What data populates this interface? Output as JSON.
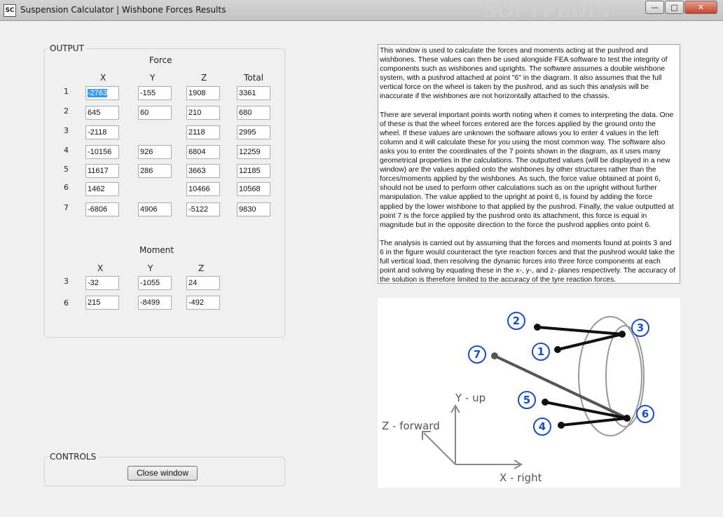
{
  "window": {
    "title": "Suspension Calculator | Wishbone Forces Results",
    "icon_text": "SC",
    "watermark": "SOFTPEDIA",
    "buttons": {
      "minimize": "—",
      "maximize": "□",
      "close": "✕"
    }
  },
  "output": {
    "group_label": "OUTPUT",
    "force": {
      "heading": "Force",
      "columns": [
        "X",
        "Y",
        "Z",
        "Total"
      ],
      "rows": [
        {
          "label": "1",
          "x": "-2763",
          "y": "-155",
          "z": "1908",
          "total": "3361"
        },
        {
          "label": "2",
          "x": "645",
          "y": "60",
          "z": "210",
          "total": "680"
        },
        {
          "label": "3",
          "x": "-2118",
          "y": "",
          "z": "2118",
          "total": "2995"
        },
        {
          "label": "4",
          "x": "-10156",
          "y": "926",
          "z": "6804",
          "total": "12259"
        },
        {
          "label": "5",
          "x": "11617",
          "y": "286",
          "z": "3663",
          "total": "12185"
        },
        {
          "label": "6",
          "x": "1462",
          "y": "",
          "z": "10466",
          "total": "10568"
        },
        {
          "label": "7",
          "x": "-6806",
          "y": "4906",
          "z": "-5122",
          "total": "9830"
        }
      ]
    },
    "moment": {
      "heading": "Moment",
      "columns": [
        "X",
        "Y",
        "Z"
      ],
      "rows": [
        {
          "label": "3",
          "x": "-32",
          "y": "-1055",
          "z": "24"
        },
        {
          "label": "6",
          "x": "215",
          "y": "-8499",
          "z": "-492"
        }
      ]
    }
  },
  "controls": {
    "group_label": "CONTROLS",
    "close_button": "Close window"
  },
  "description": {
    "paragraphs": [
      "This window is used to calculate the forces and moments acting at the pushrod and wishbones. These values can then be used alongside FEA software to test the integrity of components such as wishbones and uprights. The software assumes a double wishbone system, with a pushrod attached at point \"6\" in the diagram. It also assumes that the full vertical force on the wheel is taken by the pushrod, and as such this analysis will be inaccurate if the wishbones are not horizontally attached to the chassis.",
      "There are several important points worth noting when it comes to interpreting the data. One of these is that the wheel forces entered are the forces applied by the ground onto the wheel. If these values are unknown the software allows you to enter 4 values in the left column and it will calculate these for you using the most common way. The software also asks you to enter the coordinates of the 7 points shown in the diagram, as it uses many geometrical properties in the calculations. The outputted values (will be displayed in a new window) are the values applied onto the wishbones by other structures rather than the forces/moments applied by the wishbones. As such, the force value obtained at point 6, should not be used to perform other calculations such as on the upright without further manipulation. The value applied to the upright at point 6, is found by adding the force applied by the lower wishbone to that applied by the pushrod. Finally, the value outputted at point 7 is the force applied by the pushrod onto its attachment, this force is equal in magnitude but in the opposite direction to the force the pushrod applies onto point 6.",
      "The analysis is carried out by assuming that the forces and moments found at points 3 and 6 in the figure would counteract the tyre reaction forces and that the pushrod would take the full vertical load, then resolving the dynamic forces into three force components at each point and solving by equating these in the x-, y-, and z- planes respectively. The accuracy of the solution is therefore limited to the accuracy of the tyre reaction forces."
    ]
  },
  "diagram": {
    "points": [
      "1",
      "2",
      "3",
      "4",
      "5",
      "6",
      "7"
    ],
    "axis_y": "Y - up",
    "axis_z": "Z - forward",
    "axis_x": "X - right",
    "colors": {
      "circle": "#1a4fc4",
      "link": "#111111",
      "pushrod": "#555555",
      "wheel": "#999999"
    }
  }
}
